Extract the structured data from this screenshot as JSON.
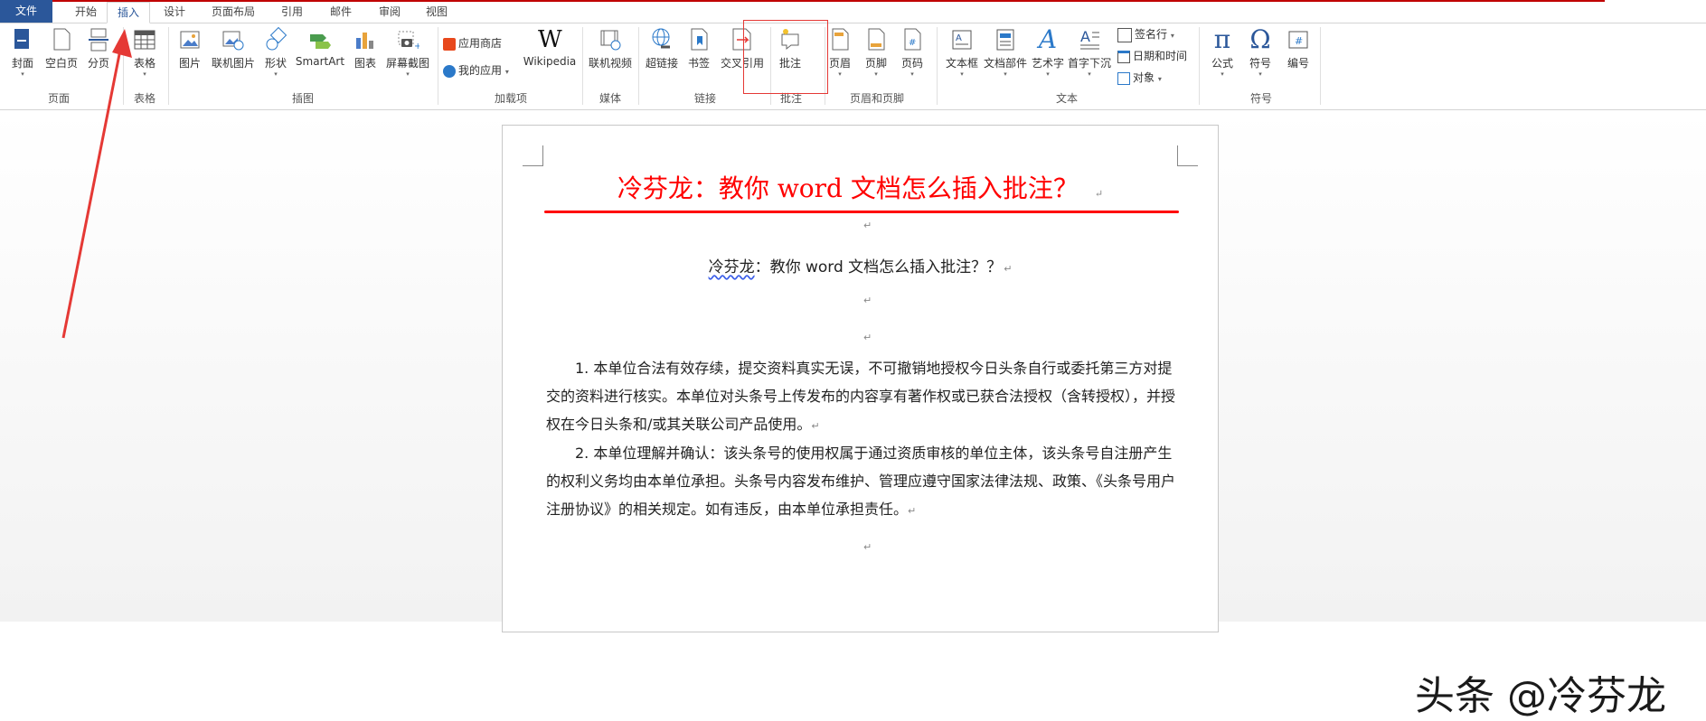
{
  "tabs": [
    {
      "label": "文件"
    },
    {
      "label": "开始"
    },
    {
      "label": "插入"
    },
    {
      "label": "设计"
    },
    {
      "label": "页面布局"
    },
    {
      "label": "引用"
    },
    {
      "label": "邮件"
    },
    {
      "label": "审阅"
    },
    {
      "label": "视图"
    }
  ],
  "ribbon": {
    "pages": {
      "cover": "封面",
      "blank": "空白页",
      "break": "分页",
      "group": "页面"
    },
    "table": {
      "table": "表格",
      "group": "表格"
    },
    "illustrations": {
      "picture": "图片",
      "online_picture": "联机图片",
      "shapes": "形状",
      "smartart": "SmartArt",
      "chart": "图表",
      "screenshot": "屏幕截图",
      "group": "插图"
    },
    "addins": {
      "store": "应用商店",
      "my_apps": "我的应用",
      "wikipedia": "Wikipedia",
      "group": "加载项"
    },
    "media": {
      "online_video": "联机视频",
      "group": "媒体"
    },
    "links": {
      "hyperlink": "超链接",
      "bookmark": "书签",
      "cross_ref": "交叉引用",
      "group": "链接"
    },
    "comments": {
      "comment": "批注",
      "group": "批注"
    },
    "header_footer": {
      "header": "页眉",
      "footer": "页脚",
      "page_number": "页码",
      "group": "页眉和页脚"
    },
    "text": {
      "textbox": "文本框",
      "quick_parts": "文档部件",
      "wordart": "艺术字",
      "dropcap": "首字下沉",
      "signature": "签名行",
      "datetime": "日期和时间",
      "object": "对象",
      "group": "文本"
    },
    "symbols": {
      "equation": "公式",
      "symbol": "符号",
      "numbering": "编号",
      "group": "符号"
    }
  },
  "document": {
    "title": "冷芬龙：教你 word 文档怎么插入批注？",
    "subtitle_name": "冷芬龙",
    "subtitle_rest": "：教你 word 文档怎么插入批注？？",
    "para1_num": "1.",
    "para1": "本单位合法有效存续，提交资料真实无误，不可撤销地授权今日头条自行或委托第三方对提交的资料进行核实。本单位对头条号上传发布的内容享有著作权或已获合法授权（含转授权），并授权在今日头条和/或其关联公司产品使用。",
    "para2_num": "2.",
    "para2": "本单位理解并确认：该头条号的使用权属于通过资质审核的单位主体，该头条号自注册产生的权利义务均由本单位承担。头条号内容发布维护、管理应遵守国家法律法规、政策、《头条号用户注册协议》的相关规定。如有违反，由本单位承担责任。",
    "para_mark": "↵"
  },
  "watermark": "头条 @冷芬龙",
  "colors": {
    "accent": "#2b579a",
    "red": "#ff0000"
  }
}
